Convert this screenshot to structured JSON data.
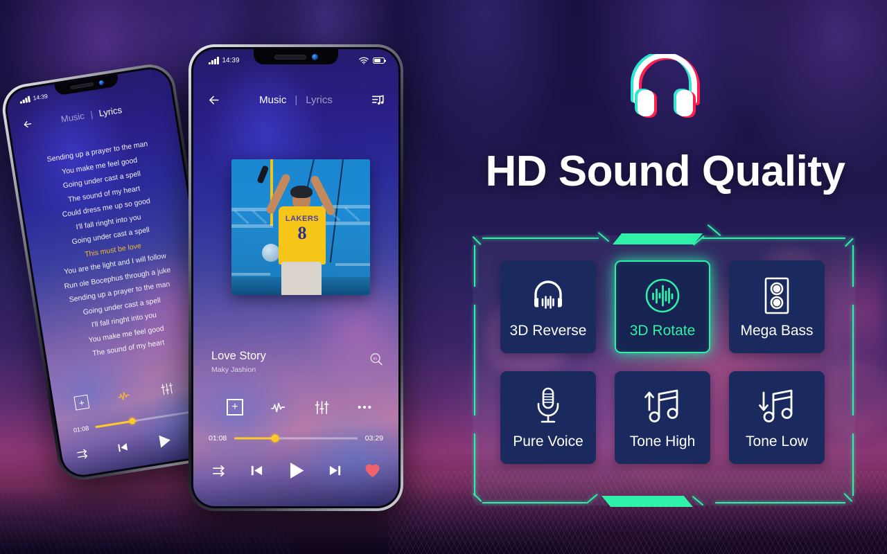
{
  "background": {
    "scene": "concert-stage",
    "accent_green": "#2ff0a8",
    "tile_navy": "#1b2a5e",
    "progress_yellow": "#ffc928",
    "heart_red": "#f0626e"
  },
  "promo": {
    "headline": "HD Sound Quality",
    "logo_icon": "headphones-icon",
    "logo_colors": {
      "cyan": "#2fe6d0",
      "red": "#ff1f4f",
      "fill": "#ffffff"
    }
  },
  "effects_panel": {
    "selected": "3D Rotate",
    "tiles": [
      {
        "label": "3D Reverse",
        "icon": "headphones-waveform-icon",
        "selected": false
      },
      {
        "label": "3D Rotate",
        "icon": "waveform-circle-icon",
        "selected": true
      },
      {
        "label": "Mega Bass",
        "icon": "speaker-cabinet-icon",
        "selected": false
      },
      {
        "label": "Pure Voice",
        "icon": "microphone-icon",
        "selected": false
      },
      {
        "label": "Tone High",
        "icon": "music-note-up-icon",
        "selected": false
      },
      {
        "label": "Tone Low",
        "icon": "music-note-down-icon",
        "selected": false
      }
    ]
  },
  "phone_main": {
    "status_bar": {
      "time": "14:39",
      "signal_icon": "signal-bars-icon",
      "wifi_icon": "wifi-icon",
      "battery_icon": "battery-icon"
    },
    "header": {
      "back_icon": "back-arrow-icon",
      "tab_music": "Music",
      "tab_separator": "|",
      "tab_lyrics": "Lyrics",
      "active_tab": "Music",
      "playlist_icon": "playlist-note-icon"
    },
    "album_art": {
      "alt": "performer in yellow Lakers 8 jersey on stage",
      "jersey_team": "LAKERS",
      "jersey_number": "8"
    },
    "now_playing": {
      "title": "Love Story",
      "artist": "Maky Jashion",
      "lrc_search_icon": "lrc-search-icon",
      "lrc_label": "lrc"
    },
    "tools": [
      {
        "icon": "add-to-playlist-icon",
        "label": "+"
      },
      {
        "icon": "sound-pulse-icon"
      },
      {
        "icon": "equalizer-icon"
      },
      {
        "icon": "more-options-icon"
      }
    ],
    "progress": {
      "elapsed": "01:08",
      "duration": "03:29",
      "percent": 33
    },
    "transport": [
      {
        "icon": "shuffle-icon"
      },
      {
        "icon": "previous-track-icon"
      },
      {
        "icon": "play-icon"
      },
      {
        "icon": "next-track-icon"
      },
      {
        "icon": "favorite-heart-icon"
      }
    ]
  },
  "phone_back": {
    "status_bar": {
      "time": "14:39",
      "signal_icon": "signal-bars-icon"
    },
    "header": {
      "back_icon": "back-arrow-icon",
      "tab_music": "Music",
      "tab_separator": "|",
      "tab_lyrics": "Lyrics",
      "active_tab": "Lyrics"
    },
    "lyrics": [
      {
        "text": "Sending up a prayer to the man",
        "highlight": false
      },
      {
        "text": "You make me feel good",
        "highlight": false
      },
      {
        "text": "Going under cast a spell",
        "highlight": false
      },
      {
        "text": "The sound of my heart",
        "highlight": false
      },
      {
        "text": "Could dress me up so good",
        "highlight": false
      },
      {
        "text": "I'll fall ringht into you",
        "highlight": false
      },
      {
        "text": "Going under cast a spell",
        "highlight": false
      },
      {
        "text": "This must be love",
        "highlight": true
      },
      {
        "text": "You are the light and I will follow",
        "highlight": false
      },
      {
        "text": "Run ole Bocephus through a juke",
        "highlight": false
      },
      {
        "text": "Sending up a prayer to the man",
        "highlight": false
      },
      {
        "text": "Going under cast a spell",
        "highlight": false
      },
      {
        "text": "I'll fall ringht into you",
        "highlight": false
      },
      {
        "text": "You make me feel good",
        "highlight": false
      },
      {
        "text": "The sound of my heart",
        "highlight": false
      }
    ],
    "tools": [
      {
        "icon": "add-to-playlist-icon",
        "label": "+"
      },
      {
        "icon": "sound-pulse-icon"
      },
      {
        "icon": "equalizer-icon"
      }
    ],
    "progress": {
      "elapsed": "01:08",
      "percent": 33
    },
    "transport": [
      {
        "icon": "shuffle-icon"
      },
      {
        "icon": "previous-track-icon"
      },
      {
        "icon": "play-icon"
      },
      {
        "icon": "next-track-icon"
      }
    ]
  }
}
